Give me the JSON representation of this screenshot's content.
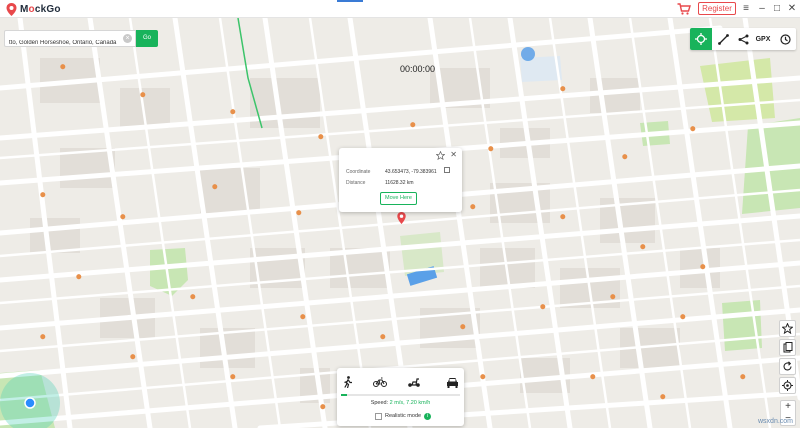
{
  "app": {
    "name_prefix": "M",
    "name_o": "o",
    "name_suffix": "ckGo",
    "register_label": "Register"
  },
  "window_controls": {
    "menu": "≡",
    "minimize": "–",
    "maximize": "□",
    "close": "✕"
  },
  "search": {
    "value": "tto, Golden Horseshoe, Ontario, Canada",
    "go_label": "Go",
    "clear": "×"
  },
  "toolbar": {
    "gpx_label": "GPX"
  },
  "timer": "00:00:00",
  "popup": {
    "coordinate_label": "Coordinate",
    "coordinate_value": "43.653473, -79.383961",
    "distance_label": "Distance",
    "distance_value": "11628.32 km",
    "move_here_label": "Move Here",
    "close": "✕"
  },
  "movement": {
    "speed_label": "Speed:",
    "speed_value": "2 m/s, 7.20 km/h",
    "speed_progress": 0.05,
    "realistic_mode_label": "Realistic mode",
    "info": "i"
  },
  "zoom": {
    "in": "+",
    "out": "−"
  },
  "watermark": "wsxdn.com",
  "colors": {
    "accent": "#18b35b",
    "brand_red": "#e8484b",
    "map_bg": "#eeece7",
    "park": "#c8e6b4",
    "road": "#ffffff",
    "water": "#a8c8f0"
  },
  "icons": [
    "mockgo-logo-icon",
    "cart-icon",
    "crosshair-icon",
    "route-icon",
    "share-icon",
    "history-icon",
    "star-icon",
    "copy-icon",
    "walk-icon",
    "bike-icon",
    "scooter-icon",
    "car-icon",
    "favorite-icon",
    "import-icon",
    "reset-icon",
    "locate-icon",
    "location-pin-icon"
  ]
}
